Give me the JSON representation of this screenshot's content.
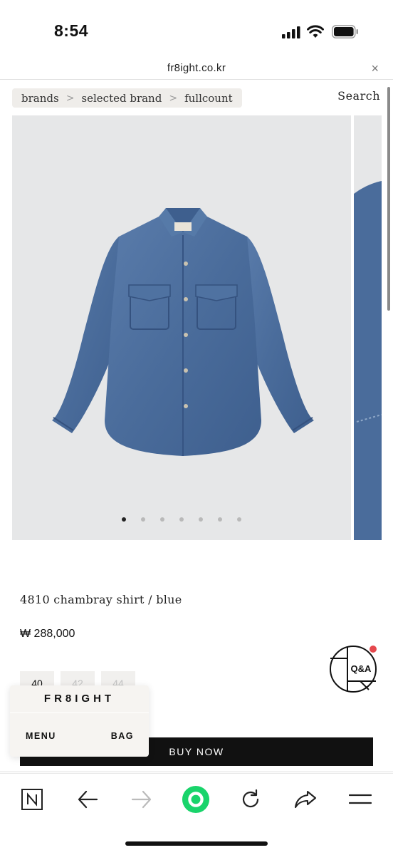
{
  "status_bar": {
    "time": "8:54",
    "signal_icon": "cellular-signal-icon",
    "wifi_icon": "wifi-icon",
    "battery_icon": "battery-icon"
  },
  "url_bar": {
    "url": "fr8ight.co.kr",
    "close_symbol": "×"
  },
  "breadcrumb": {
    "items": [
      "brands",
      "selected brand",
      "fullcount"
    ],
    "separator": ">"
  },
  "search_label": "Search",
  "gallery": {
    "image_icon": "shirt-icon",
    "slide_count": 7,
    "active_slide": 1,
    "background": "#e6e7e8",
    "shirt_color": "#4d6f9e"
  },
  "product": {
    "name": "4810 chambray shirt / blue",
    "price": "₩ 288,000"
  },
  "sizes": [
    {
      "label": "40",
      "available": true
    },
    {
      "label": "42",
      "available": false
    },
    {
      "label": "44",
      "available": false
    }
  ],
  "qa_badge": {
    "label": "Q&A",
    "notification_color": "#e5484d"
  },
  "float_menu": {
    "brand": "FR8IGHT",
    "menu_label": "MENU",
    "bag_label": "BAG"
  },
  "buy_now_label": "BUY NOW",
  "toolbar": {
    "items": [
      "naver-home-icon",
      "back-arrow-icon",
      "forward-arrow-icon",
      "green-dot-icon",
      "reload-icon",
      "share-icon",
      "hamburger-menu-icon"
    ],
    "accent_color": "#19d46b"
  }
}
